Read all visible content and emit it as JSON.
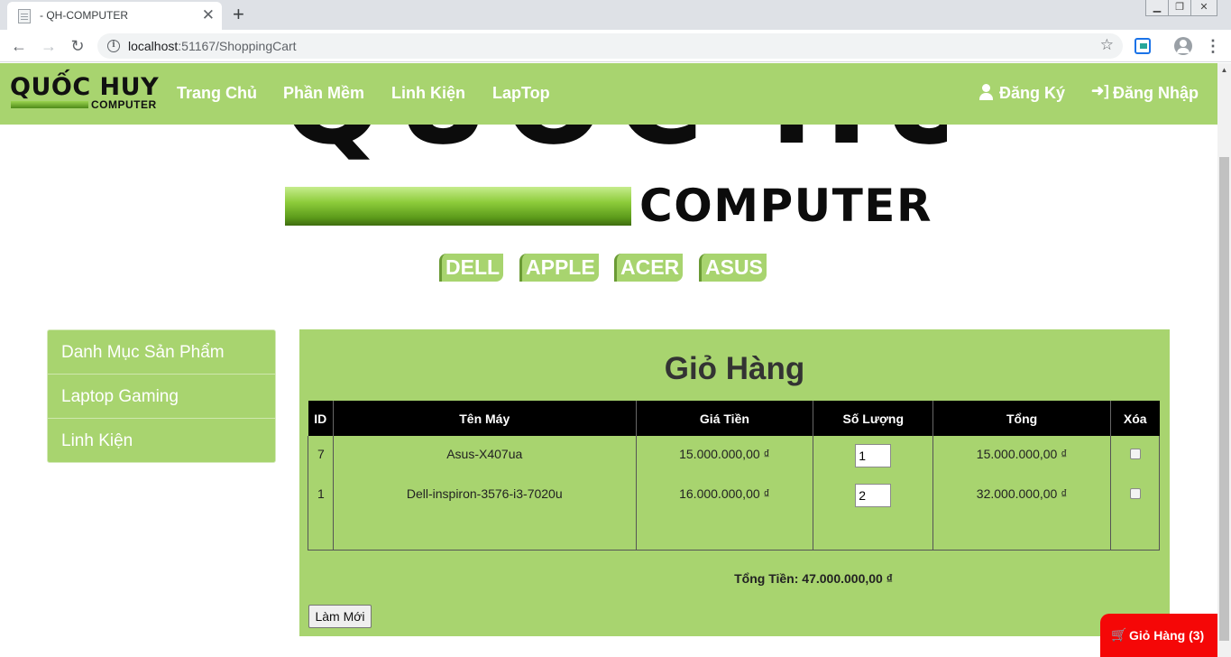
{
  "browser": {
    "tab_title": "- QH-COMPUTER",
    "tab_close": "✕",
    "new_tab": "+",
    "url_host": "localhost",
    "url_path": ":51167/ShoppingCart",
    "back": "←",
    "forward": "→",
    "reload": "↻",
    "star": "☆",
    "menu": "⋮"
  },
  "navbar": {
    "logo_main": "QUỐC HUY",
    "logo_sub": "COMPUTER",
    "links": [
      "Trang Chủ",
      "Phần Mềm",
      "Linh Kiện",
      "LapTop"
    ],
    "register": "Đăng Ký",
    "login": "Đăng Nhập"
  },
  "banner": {
    "title": "QUỐC HUY",
    "subtitle": "COMPUTER"
  },
  "brands": [
    "DELL",
    "APPLE",
    "ACER",
    "ASUS"
  ],
  "sidebar": {
    "items": [
      "Danh Mục Sản Phẩm",
      "Laptop Gaming",
      "Linh Kiện"
    ]
  },
  "cart": {
    "title": "Giỏ Hàng",
    "columns": [
      "ID",
      "Tên Máy",
      "Giá Tiền",
      "Số Lượng",
      "Tổng",
      "Xóa"
    ],
    "rows": [
      {
        "id": "7",
        "name": "Asus-X407ua",
        "price": "15.000.000,00 ₫",
        "qty": "1",
        "total": "15.000.000,00 ₫"
      },
      {
        "id": "1",
        "name": "Dell-inspiron-3576-i3-7020u",
        "price": "16.000.000,00 ₫",
        "qty": "2",
        "total": "32.000.000,00 ₫"
      }
    ],
    "grand_total": "Tổng Tiền: 47.000.000,00 ₫",
    "refresh_label": "Làm Mới"
  },
  "floating_cart": {
    "label": "Giỏ Hàng (3)"
  },
  "colors": {
    "brand_green": "#a8d46f",
    "cart_button": "#f50707"
  }
}
